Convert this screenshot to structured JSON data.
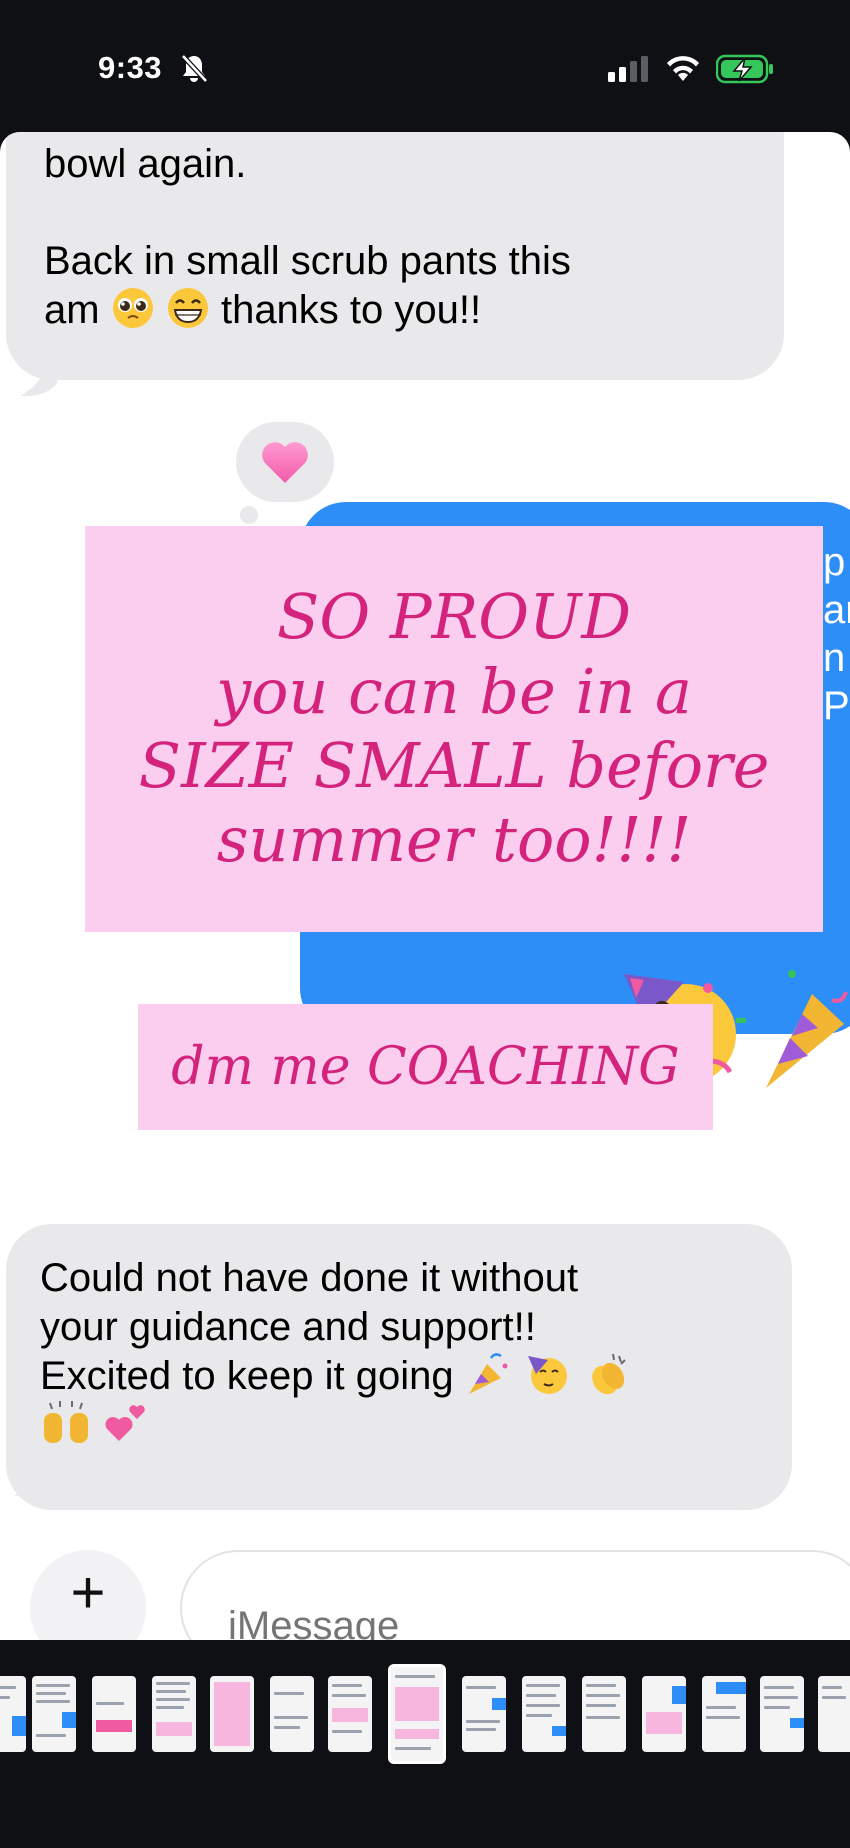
{
  "status_bar": {
    "time": "9:33",
    "bell_icon": "bell-slash-icon",
    "signal_icon": "cellular-signal-icon",
    "wifi_icon": "wifi-icon",
    "battery_icon": "battery-charging-icon",
    "battery_color": "#35c759"
  },
  "messages": {
    "first": {
      "line1": "bowl again.",
      "line2a": "Back in small scrub pants this",
      "line2b_start": "am",
      "line2b_end": "thanks to you!!"
    },
    "tapback": {
      "icon": "pink-heart-icon"
    },
    "promo": {
      "lines": [
        "SO PROUD",
        "you can be in a",
        "SIZE SMALL before",
        "summer too!!!!"
      ],
      "cta": "dm me COACHING",
      "text_color": "#d4237c",
      "card_color": "#fbcdee"
    },
    "blue_fragments": [
      "p",
      "ar",
      "n",
      "PE"
    ],
    "last": {
      "line1": "Could not have done it without",
      "line2": "your guidance and support!!",
      "line3": "Excited to keep it going"
    },
    "blue_color": "#2e8ef7",
    "grey_color": "#e9e9eb"
  },
  "composer": {
    "plus_label": "+",
    "placeholder": "iMessage"
  },
  "thumbnail_strip": {
    "count": 14,
    "active_index": 6
  }
}
